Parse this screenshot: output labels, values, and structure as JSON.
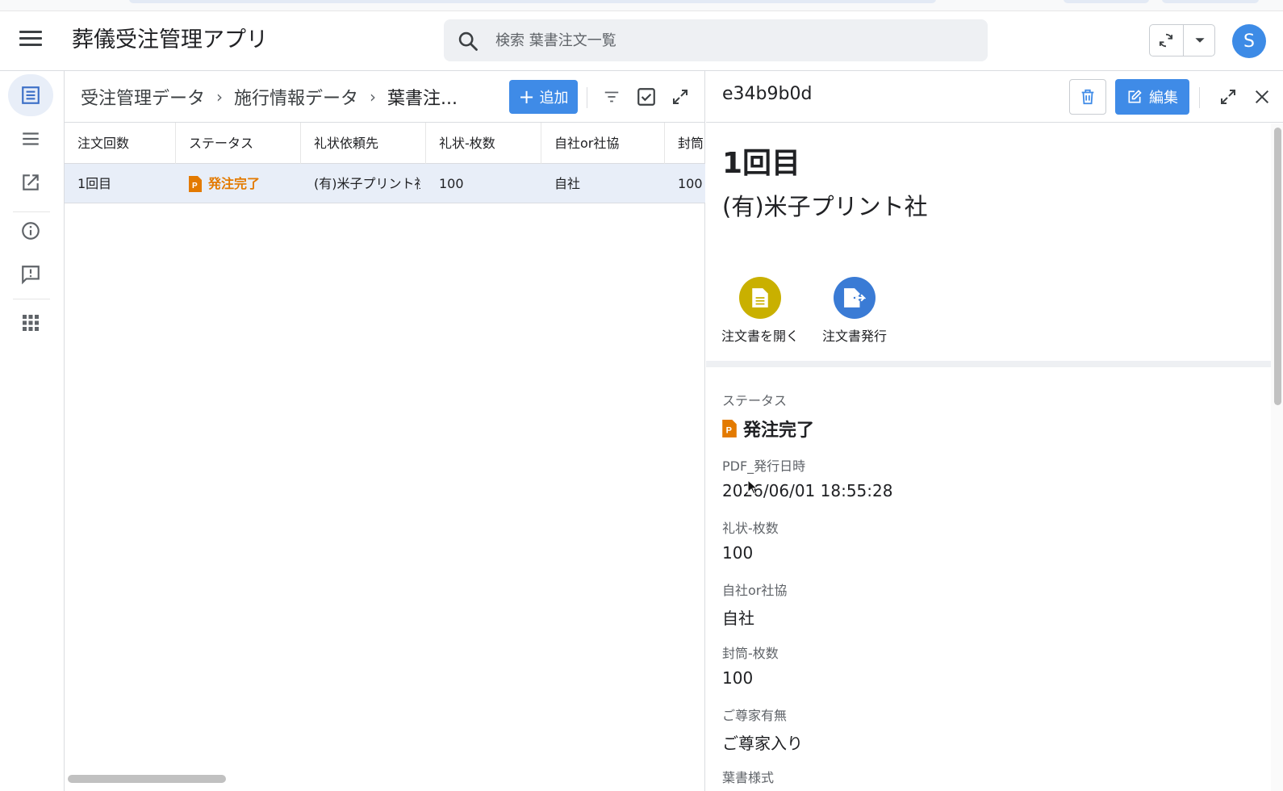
{
  "app": {
    "title": "葬儀受注管理アプリ",
    "search_placeholder": "検索 葉書注文一覧",
    "avatar_initial": "S"
  },
  "icons": {
    "menu": "hamburger-icon",
    "search": "search-icon",
    "sync": "sync-icon",
    "dropdown": "caret-down-icon",
    "rail": [
      "table-view-icon",
      "list-view-icon",
      "open-external-icon",
      "info-icon",
      "feedback-icon",
      "apps-grid-icon"
    ],
    "toolbar": [
      "filter-icon",
      "checkbox-icon",
      "expand-icon"
    ],
    "detail": [
      "trash-icon",
      "edit-icon",
      "expand-icon",
      "close-icon"
    ]
  },
  "colors": {
    "accent": "#3f8be7",
    "status_orange": "#e37a00",
    "selected_row": "#e8eef8",
    "open_doc_circle": "#c9b000",
    "issue_doc_circle": "#3a7bd5"
  },
  "list": {
    "breadcrumb": [
      "受注管理データ",
      "施行情報データ",
      "葉書注..."
    ],
    "add_label": "追加",
    "columns": [
      "注文回数",
      "ステータス",
      "礼状依頼先",
      "礼状-枚数",
      "自社or社協",
      "封筒"
    ],
    "rows": [
      {
        "order_no": "1回目",
        "status": "発注完了",
        "vendor": "(有)米子プリント社",
        "letters": "100",
        "type": "自社",
        "envelopes": "100"
      }
    ]
  },
  "detail": {
    "record_id": "e34b9b0d",
    "edit_label": "編集",
    "title": "1回目",
    "subtitle": "(有)米子プリント社",
    "actions": [
      {
        "label": "注文書を開く"
      },
      {
        "label": "注文書発行"
      }
    ],
    "fields": [
      {
        "label": "ステータス",
        "value": "発注完了"
      },
      {
        "label": "PDF_発行日時",
        "value": "2026/06/01 18:55:28"
      },
      {
        "label": "礼状-枚数",
        "value": "100"
      },
      {
        "label": "自社or社協",
        "value": "自社"
      },
      {
        "label": "封筒-枚数",
        "value": "100"
      },
      {
        "label": "ご尊家有無",
        "value": "ご尊家入り"
      },
      {
        "label": "葉書様式",
        "value": ""
      }
    ]
  }
}
